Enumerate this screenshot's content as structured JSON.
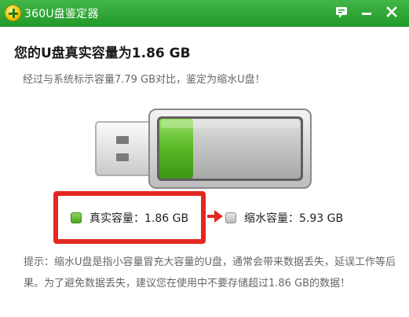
{
  "window": {
    "title": "360U盘鉴定器"
  },
  "result": {
    "headline": "您的U盘真实容量为1.86 GB",
    "subline": "经过与系统标示容量7.79 GB对比，鉴定为缩水U盘！"
  },
  "capacity": {
    "real_fraction": 0.239
  },
  "legend": {
    "real": "真实容量：1.86 GB",
    "shrink": "缩水容量：5.93 GB"
  },
  "tip": {
    "text": "提示：缩水U盘是指小容量冒充大容量的U盘，通常会带来数据丢失，延误工作等后果。为了避免数据丢失，建议您在使用中不要存储超过1.86 GB的数据！"
  },
  "colors": {
    "titlebar": "#2fa637",
    "real": "#52b01f",
    "shrink": "#bdbdbd",
    "highlight": "#e42722"
  }
}
